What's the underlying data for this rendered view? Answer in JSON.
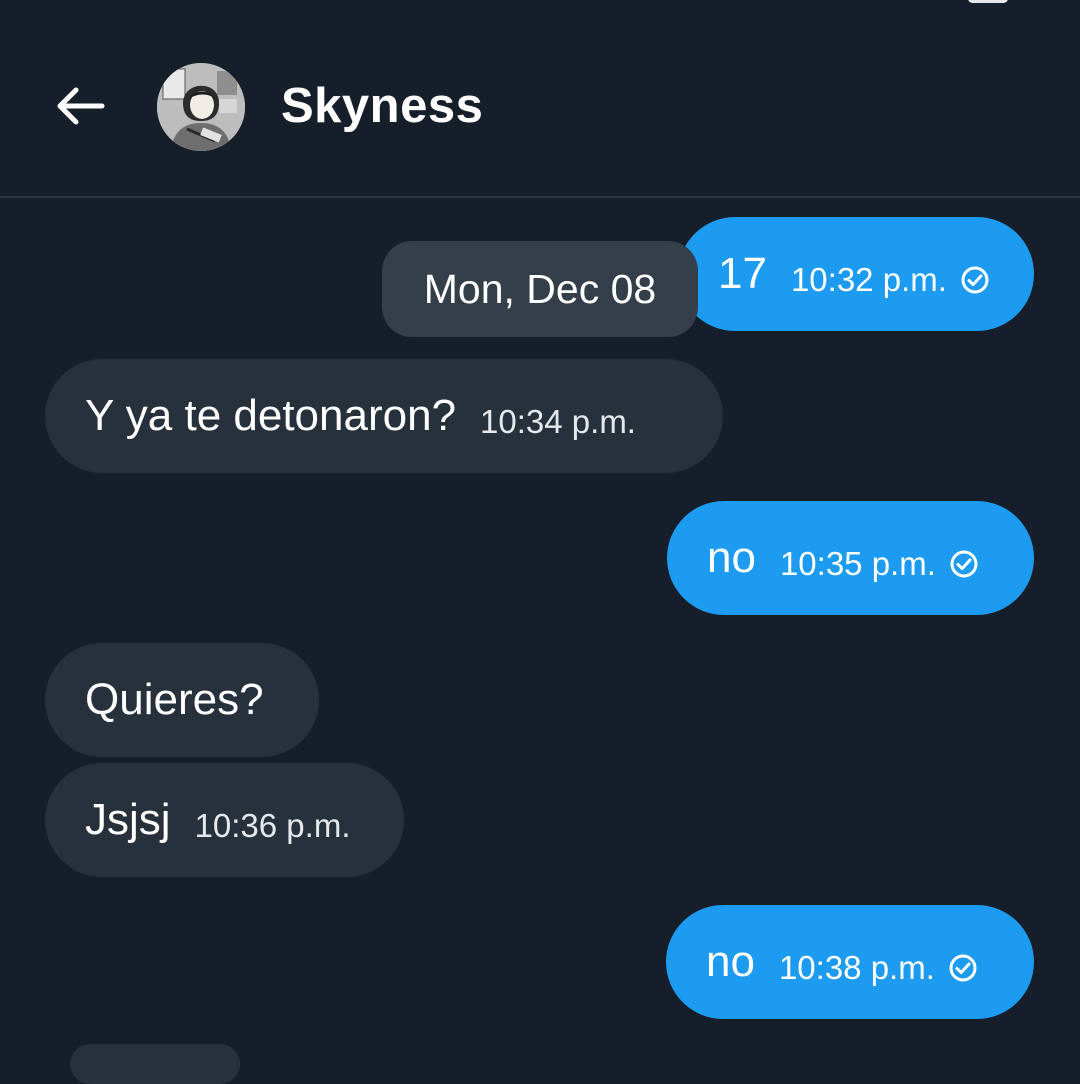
{
  "header": {
    "back_icon": "arrow-left-icon",
    "contact_name": "Skyness",
    "avatar_icon": "avatar-illustration"
  },
  "date_separator": "Mon, Dec 08",
  "messages": [
    {
      "direction": "outgoing",
      "text": "17",
      "time": "10:32 p.m.",
      "status_icon": "check-circle-icon"
    },
    {
      "direction": "incoming",
      "text": "Y ya te detonaron?",
      "time": "10:34 p.m."
    },
    {
      "direction": "outgoing",
      "text": "no",
      "time": "10:35 p.m.",
      "status_icon": "check-circle-icon"
    },
    {
      "direction": "incoming",
      "text": "Quieres?",
      "time": ""
    },
    {
      "direction": "incoming",
      "text": "Jsjsj",
      "time": "10:36 p.m."
    },
    {
      "direction": "outgoing",
      "text": "no",
      "time": "10:38 p.m.",
      "status_icon": "check-circle-icon"
    }
  ],
  "colors": {
    "background": "#161f29",
    "outgoing_bubble": "#1d9bf0",
    "incoming_bubble": "#27313c",
    "date_chip": "#343f4a",
    "divider": "#2a3641",
    "text": "#ffffff"
  }
}
